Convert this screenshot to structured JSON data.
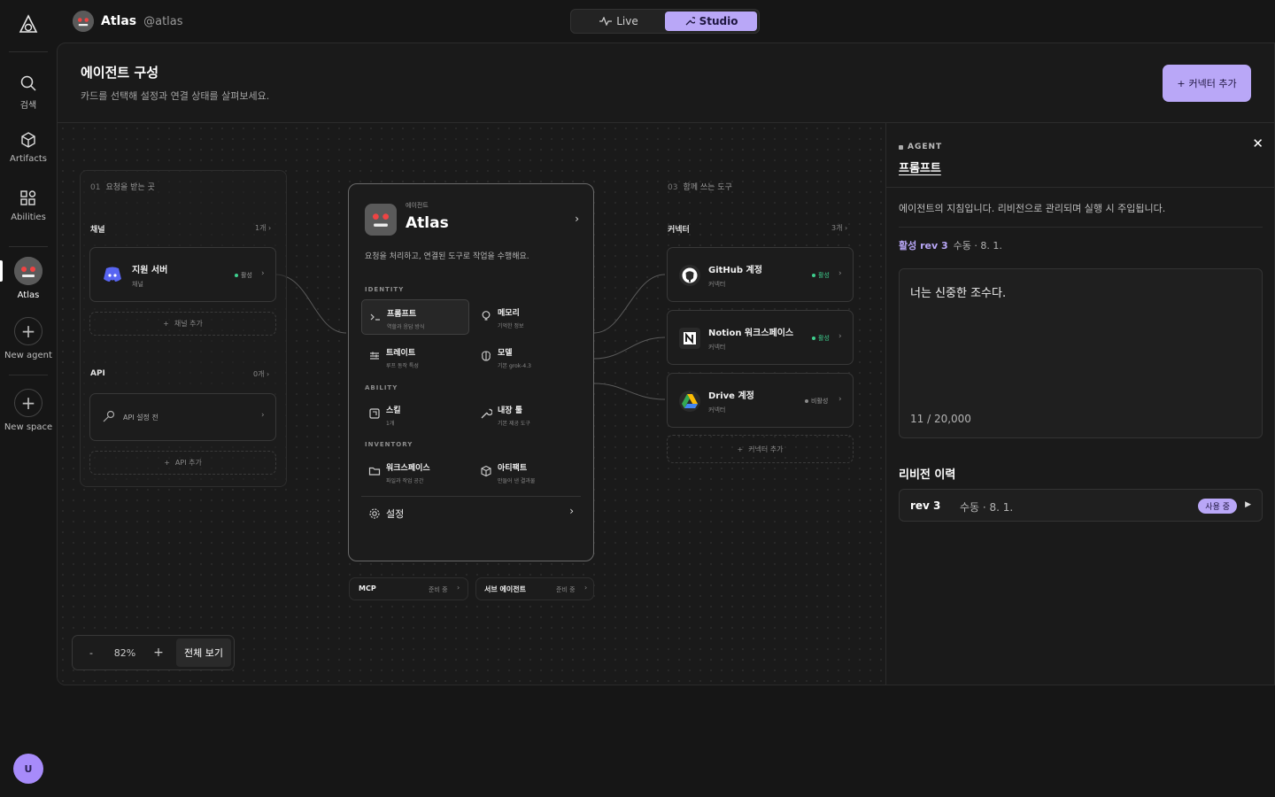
{
  "rail": {
    "items": [
      {
        "label": "검색",
        "icon": "search-icon"
      },
      {
        "label": "Artifacts",
        "icon": "cube-icon"
      },
      {
        "label": "Abilities",
        "icon": "grid-icon"
      },
      {
        "label": "Atlas",
        "icon": "robot-avatar"
      },
      {
        "label": "New agent",
        "icon": "plus-icon"
      },
      {
        "label": "New space",
        "icon": "plus-icon"
      }
    ],
    "user_initial": "U"
  },
  "topbar": {
    "agent_name": "Atlas",
    "agent_handle": "@atlas",
    "modes": [
      "Live",
      "Studio"
    ],
    "active_mode": "Studio"
  },
  "header": {
    "title": "에이전트 구성",
    "subtitle": "카드를 선택해 설정과 연결 상태를 살펴보세요.",
    "add_connector": "커넥터 추가"
  },
  "inputs_column": {
    "label": "요청을 받는 곳",
    "num": "01",
    "channel": {
      "title": "채널",
      "count": "1개",
      "card": {
        "title": "지원 서버",
        "sub": "채널",
        "status": "활성"
      },
      "add": "채널 추가"
    },
    "api": {
      "title": "API",
      "count": "0개",
      "card": {
        "title": "API 설정 전"
      },
      "add": "API 추가"
    }
  },
  "center": {
    "eyebrow": "에이전트",
    "name": "Atlas",
    "desc": "요청을 처리하고, 연결된 도구로 작업을 수행해요.",
    "identity_label": "IDENTITY",
    "ability_label": "ABILITY",
    "inventory_label": "INVENTORY",
    "items": {
      "prompt": {
        "title": "프롬프트",
        "sub": "역할과 응답 방식"
      },
      "memory": {
        "title": "메모리",
        "sub": "기억한 정보"
      },
      "trait": {
        "title": "트레이트",
        "sub": "루프 동작 특성"
      },
      "model": {
        "title": "모델",
        "sub": "기본 grok-4.3"
      },
      "skill": {
        "title": "스킬",
        "sub": "1개"
      },
      "builtin": {
        "title": "내장 툴",
        "sub": "기본 제공 도구"
      },
      "workspace": {
        "title": "워크스페이스",
        "sub": "파일과 작업 공간"
      },
      "artifact": {
        "title": "아티팩트",
        "sub": "만들어 낸 결과물"
      }
    },
    "settings": "설정",
    "mcp": {
      "label": "MCP",
      "status": "준비 중"
    },
    "subagent": {
      "label": "서브 에이전트",
      "status": "준비 중"
    }
  },
  "tools_column": {
    "num": "03",
    "label": "함께 쓰는 도구",
    "title": "커넥터",
    "count": "3개",
    "cards": [
      {
        "title": "GitHub 계정",
        "sub": "커넥터",
        "status": "활성",
        "icon": "github-icon"
      },
      {
        "title": "Notion 워크스페이스",
        "sub": "커넥터",
        "status": "활성",
        "icon": "notion-icon"
      },
      {
        "title": "Drive 계정",
        "sub": "커넥터",
        "status": "비활성",
        "icon": "drive-icon"
      }
    ],
    "add": "커넥터 추가"
  },
  "zoom": {
    "minus": "-",
    "level": "82%",
    "plus": "+",
    "fit": "전체 보기"
  },
  "panel": {
    "tag": "AGENT",
    "title": "프롬프트",
    "desc": "에이전트의 지침입니다. 리비전으로 관리되며 실행 시 주입됩니다.",
    "active_rev": "활성 rev 3",
    "active_meta": "수동 · 8. 1.",
    "prompt_text": "너는 신중한 조수다.",
    "char_count": "11 / 20,000",
    "history_title": "리비전 이력",
    "history": [
      {
        "rev": "rev 3",
        "meta": "수동 · 8. 1.",
        "badge": "사용 중"
      }
    ]
  },
  "colors": {
    "accent": "#b9a7f7",
    "active_dot": "#3ecf8e",
    "inactive_dot": "#8a8a8a"
  }
}
